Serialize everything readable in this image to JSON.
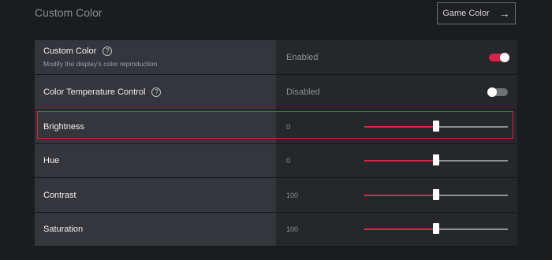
{
  "header": {
    "title": "Custom Color",
    "game_color_label": "Game Color",
    "game_color_icon": "arrow-right-icon"
  },
  "colors": {
    "accent": "#d8234a",
    "highlight": "#e0203b"
  },
  "rows": [
    {
      "key": "custom-color",
      "label": "Custom Color",
      "sublabel": "Modify the display's color reproduction",
      "help": "?",
      "type": "toggle",
      "value": "Enabled",
      "on": true
    },
    {
      "key": "color-temperature-control",
      "label": "Color Temperature Control",
      "help": "?",
      "type": "toggle",
      "value": "Disabled",
      "on": false
    },
    {
      "key": "brightness",
      "label": "Brightness",
      "type": "slider",
      "value": "0",
      "level": 0.5,
      "highlighted": true
    },
    {
      "key": "hue",
      "label": "Hue",
      "type": "slider",
      "value": "0",
      "level": 0.5
    },
    {
      "key": "contrast",
      "label": "Contrast",
      "type": "slider",
      "value": "100",
      "level": 0.5
    },
    {
      "key": "saturation",
      "label": "Saturation",
      "type": "slider",
      "value": "100",
      "level": 0.5
    }
  ]
}
